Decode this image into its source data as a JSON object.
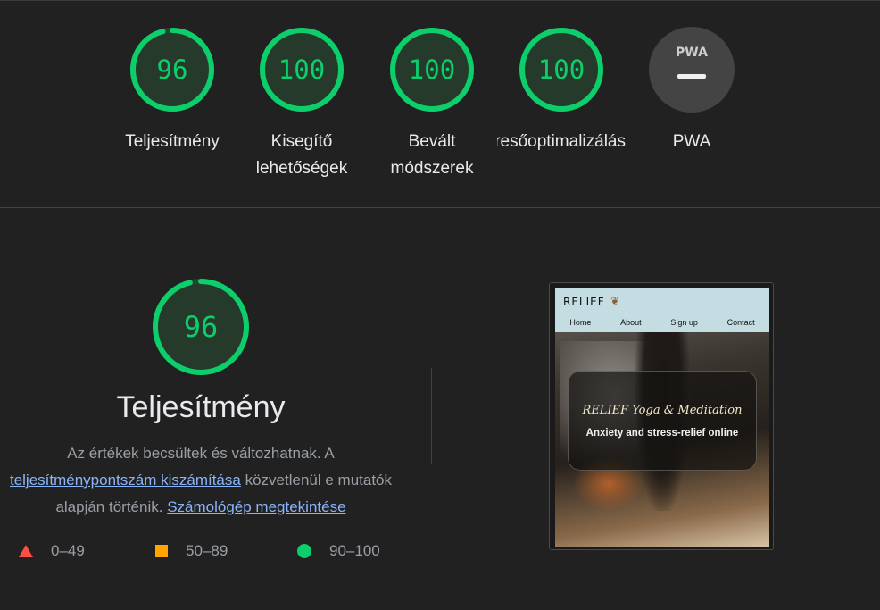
{
  "categories": [
    {
      "score": "96",
      "label": "Teljesítmény",
      "fraction": 0.96
    },
    {
      "score": "100",
      "label": "Kisegítő lehetőségek",
      "fraction": 1.0
    },
    {
      "score": "100",
      "label": "Bevált módszerek",
      "fraction": 1.0
    },
    {
      "score": "100",
      "label": "Keresőoptimalizálás",
      "fraction": 1.0
    },
    {
      "score": "—",
      "label": "PWA",
      "badge": "PWA"
    }
  ],
  "performance": {
    "score": "96",
    "fraction": 0.96,
    "title": "Teljesítmény",
    "desc_part1": "Az értékek becsültek és változhatnak. A",
    "desc_link1": "teljesítménypontszám kiszámítása",
    "desc_part2": "közvetlenül e mutatók alapján történik.",
    "desc_link2": "Számológép megtekintése"
  },
  "legend": [
    {
      "range": "0–49",
      "icon": "triangle-icon",
      "color": "#ff4e42"
    },
    {
      "range": "50–89",
      "icon": "square-icon",
      "color": "#ffa400"
    },
    {
      "range": "90–100",
      "icon": "circle-icon",
      "color": "#0cce6b"
    }
  ],
  "screenshot": {
    "logo": "RELIEF",
    "nav": [
      "Home",
      "About",
      "Sign up",
      "Contact"
    ],
    "hero_title": "RELIEF Yoga & Meditation",
    "hero_sub": "Anxiety and stress-relief online"
  },
  "colors": {
    "pass": "#0cce6b",
    "average": "#ffa400",
    "fail": "#ff4e42",
    "link": "#8ab4f8",
    "background": "#212121"
  }
}
